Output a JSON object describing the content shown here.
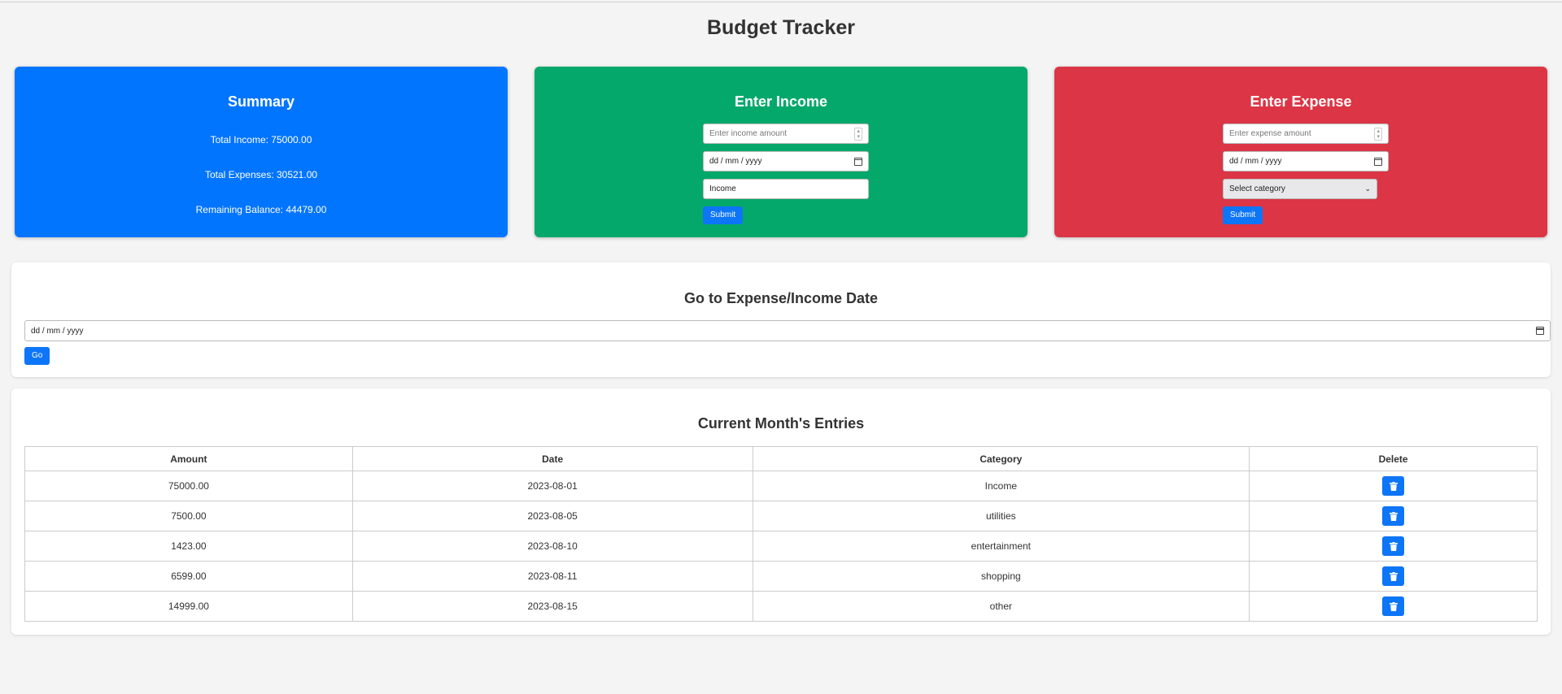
{
  "app": {
    "title": "Budget Tracker"
  },
  "summary": {
    "title": "Summary",
    "total_income": "Total Income: 75000.00",
    "total_expenses": "Total Expenses: 30521.00",
    "remaining": "Remaining Balance: 44479.00"
  },
  "income_form": {
    "title": "Enter Income",
    "amount_placeholder": "Enter income amount",
    "date_placeholder": "dd / mm / yyyy",
    "category_value": "Income",
    "submit_label": "Submit"
  },
  "expense_form": {
    "title": "Enter Expense",
    "amount_placeholder": "Enter expense amount",
    "date_placeholder": "dd / mm / yyyy",
    "category_placeholder": "Select category",
    "submit_label": "Submit"
  },
  "goto": {
    "title": "Go to Expense/Income Date",
    "date_placeholder": "dd / mm / yyyy",
    "go_label": "Go"
  },
  "entries": {
    "title": "Current Month's Entries",
    "columns": [
      "Amount",
      "Date",
      "Category",
      "Delete"
    ],
    "rows": [
      {
        "amount": "75000.00",
        "date": "2023-08-01",
        "category": "Income"
      },
      {
        "amount": "7500.00",
        "date": "2023-08-05",
        "category": "utilities"
      },
      {
        "amount": "1423.00",
        "date": "2023-08-10",
        "category": "entertainment"
      },
      {
        "amount": "6599.00",
        "date": "2023-08-11",
        "category": "shopping"
      },
      {
        "amount": "14999.00",
        "date": "2023-08-15",
        "category": "other"
      }
    ]
  },
  "colors": {
    "summary": "#0275ff",
    "income": "#05a86b",
    "expense": "#dc3545",
    "button": "#0d75f8"
  },
  "icons": {
    "delete": "trash-icon",
    "calendar": "calendar-icon"
  }
}
